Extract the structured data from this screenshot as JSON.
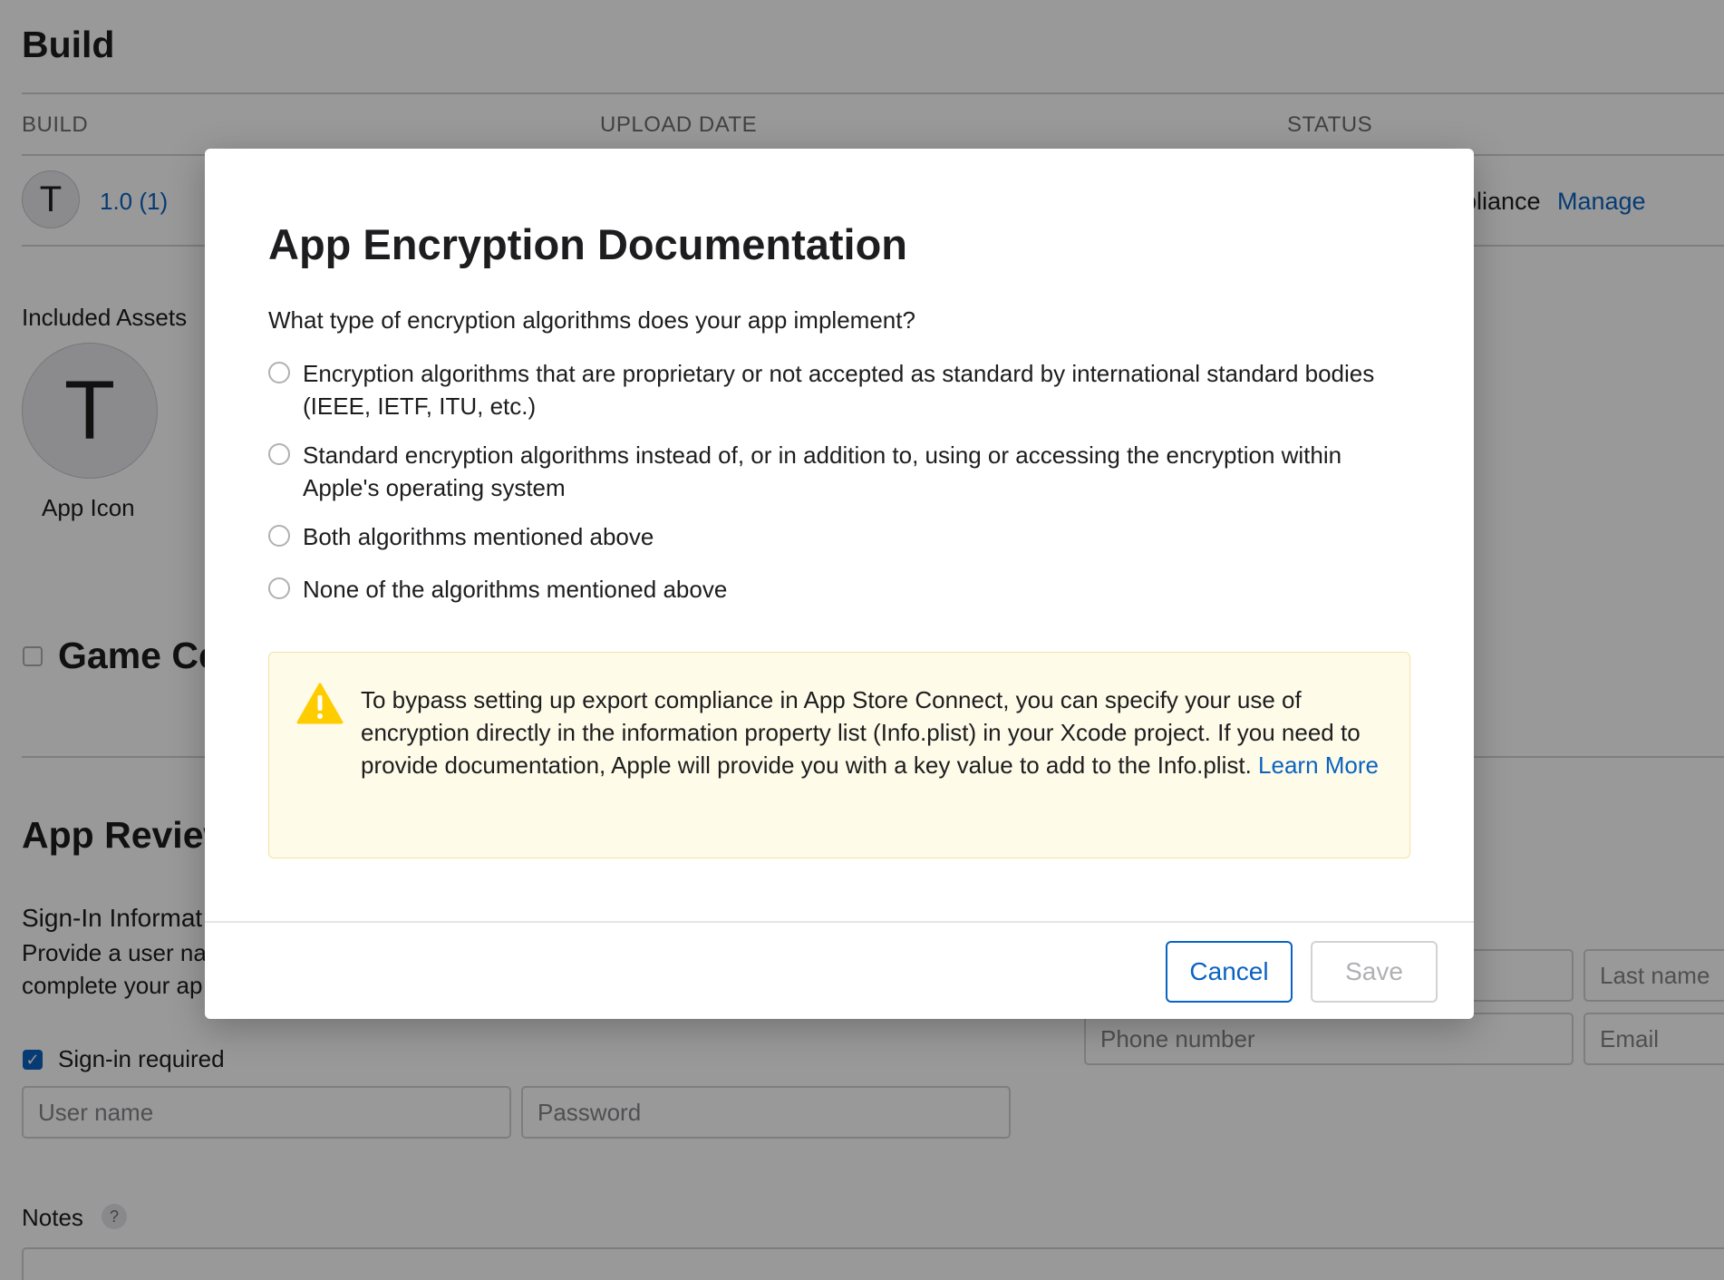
{
  "background": {
    "build_section": {
      "title": "Build",
      "columns": [
        "BUILD",
        "UPLOAD DATE",
        "STATUS"
      ],
      "row": {
        "avatar_letter": "T",
        "version": "1.0 (1)",
        "status_partial": "pliance",
        "manage_link": "Manage"
      }
    },
    "assets": {
      "label": "Included Assets",
      "icon_letter": "T",
      "icon_caption": "App Icon"
    },
    "game_center": {
      "title_partial": "Game Ce",
      "checked": false
    },
    "app_review": {
      "title_partial": "App Review",
      "signin_title_partial": "Sign-In Informat",
      "signin_desc_line1": "Provide a user na",
      "signin_desc_line2": "complete your ap",
      "signin_required_label": "Sign-in required",
      "signin_required_checked": true,
      "username_placeholder": "User name",
      "password_placeholder": "Password",
      "lastname_placeholder": "Last name",
      "phone_placeholder": "Phone number",
      "email_placeholder": "Email",
      "notes_label": "Notes",
      "notes_help": "?"
    }
  },
  "modal": {
    "title": "App Encryption Documentation",
    "question": "What type of encryption algorithms does your app implement?",
    "options": [
      {
        "label": "Encryption algorithms that are proprietary or not accepted as standard by international standard bodies (IEEE, IETF, ITU, etc.)",
        "selected": false
      },
      {
        "label": "Standard encryption algorithms instead of, or in addition to, using or accessing the encryption within Apple's operating system",
        "selected": false
      },
      {
        "label": "Both algorithms mentioned above",
        "selected": false
      },
      {
        "label": "None of the algorithms mentioned above",
        "selected": false
      }
    ],
    "notice": {
      "text": "To bypass setting up export compliance in App Store Connect, you can specify your use of encryption directly in the information property list (Info.plist) in your Xcode project. If you need to provide documentation, Apple will provide you with a key value to add to the Info.plist.",
      "link": "Learn More",
      "icon": "warning-icon"
    },
    "buttons": {
      "cancel": "Cancel",
      "save": "Save"
    }
  },
  "colors": {
    "accent": "#0a63c2",
    "notice_bg": "#fefbe8",
    "warning": "#ffcc00"
  }
}
